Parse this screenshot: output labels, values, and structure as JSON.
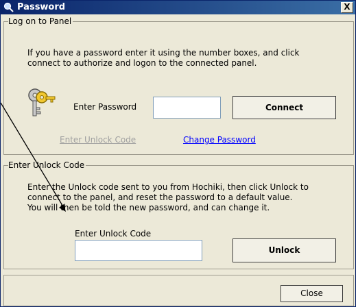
{
  "window": {
    "title": "Password",
    "close_glyph": "X"
  },
  "logon": {
    "legend": "Log on to Panel",
    "instruction_line1": "If you have a password enter it using the number boxes, and click",
    "instruction_line2": "connect to authorize and logon to the connected panel.",
    "password_label": "Enter Password",
    "password_value": "",
    "connect_label": "Connect",
    "unlock_link": "Enter Unlock Code",
    "change_link": "Change Password"
  },
  "unlock": {
    "legend": "Enter Unlock Code",
    "instruction_line1": "Enter the Unlock code sent to you from Hochiki, then click Unlock to",
    "instruction_line2": "connect to the panel, and reset the password to a default value.",
    "instruction_line3": "You will then be told the new password, and can change it.",
    "code_label": "Enter Unlock Code",
    "code_value": "",
    "unlock_label": "Unlock"
  },
  "footer": {
    "close_label": "Close"
  },
  "colors": {
    "titlebar_start": "#0a246a",
    "titlebar_end": "#3a6ea5",
    "link": "#0000ff",
    "disabled": "#a0a0a0"
  },
  "icons": [
    "app-icon",
    "keys-icon"
  ]
}
